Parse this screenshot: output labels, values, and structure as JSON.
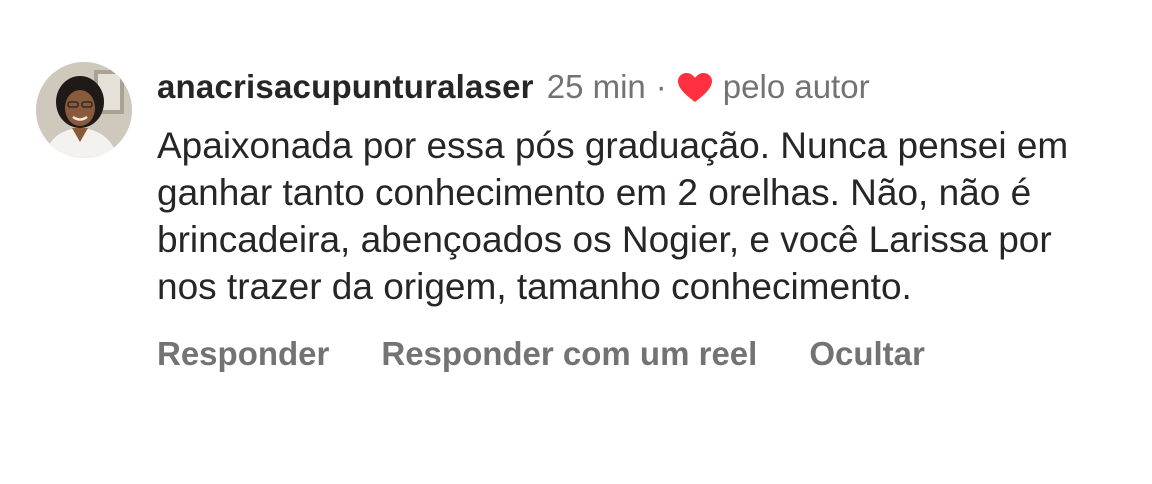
{
  "comment": {
    "username": "anacrisacupunturalaser",
    "time": "25 min",
    "separator": "·",
    "liked_by_author_label": "pelo autor",
    "text": "Apaixonada por essa pós graduação. Nunca pensei em ganhar tanto conhecimento em 2 orelhas. Não, não é brincadeira, abençoados os Nogier, e você Larissa por nos trazer da origem, tamanho conhecimento.",
    "actions": {
      "reply": "Responder",
      "reply_with_reel": "Responder com um reel",
      "hide": "Ocultar"
    }
  },
  "icons": {
    "heart": "heart-icon"
  },
  "colors": {
    "heart": "#ff3040",
    "primary_text": "#262626",
    "secondary_text": "#737373",
    "background": "#ffffff"
  }
}
